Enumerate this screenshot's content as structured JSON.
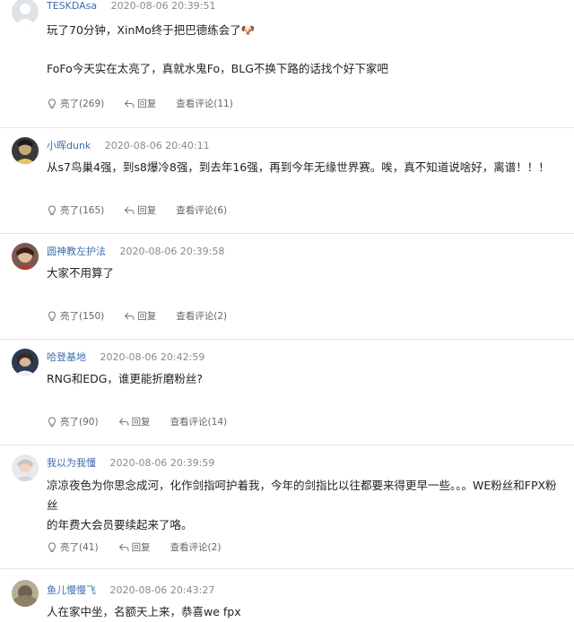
{
  "comments": [
    {
      "username": "TESKDAsa",
      "time": "2020-08-06 20:39:51",
      "line1": "玩了70分钟，XinMo终于把巴德练会了🐶",
      "line2": "FoFo今天实在太亮了，真就水鬼Fo，BLG不换下路的话找个好下家吧",
      "like": "亮了(269)",
      "reply": "回复",
      "view": "查看评论(11)"
    },
    {
      "username": "小晖dunk",
      "time": "2020-08-06 20:40:11",
      "line1": "从s7鸟巢4强，到s8爆冷8强，到去年16强，再到今年无缘世界赛。唉，真不知道说啥好，离谱！！！",
      "like": "亮了(165)",
      "reply": "回复",
      "view": "查看评论(6)"
    },
    {
      "username": "圆神教左护法",
      "time": "2020-08-06 20:39:58",
      "line1": "大家不用算了",
      "like": "亮了(150)",
      "reply": "回复",
      "view": "查看评论(2)"
    },
    {
      "username": "哈登基地",
      "time": "2020-08-06 20:42:59",
      "line1": "RNG和EDG，谁更能折磨粉丝?",
      "like": "亮了(90)",
      "reply": "回复",
      "view": "查看评论(14)"
    },
    {
      "username": "我以为我懂",
      "time": "2020-08-06 20:39:59",
      "line1": "凉凉夜色为你思念成河，化作剑指呵护着我，今年的剑指比以往都要来得更早一些。。。WE粉丝和FPX粉丝",
      "line2": "的年费大会员要续起来了咯。",
      "like": "亮了(41)",
      "reply": "回复",
      "view": "查看评论(2)"
    },
    {
      "username": "鱼儿慢慢飞",
      "time": "2020-08-06 20:43:27",
      "line1": "人在家中坐，名额天上来，恭喜we fpx"
    }
  ],
  "colors": {
    "username": "#3e6ea8",
    "time": "#8a8a8a",
    "action": "#666666",
    "divider": "#e6e6e6"
  },
  "icons": {
    "like": "lightbulb-icon",
    "reply": "reply-arrow-icon"
  }
}
